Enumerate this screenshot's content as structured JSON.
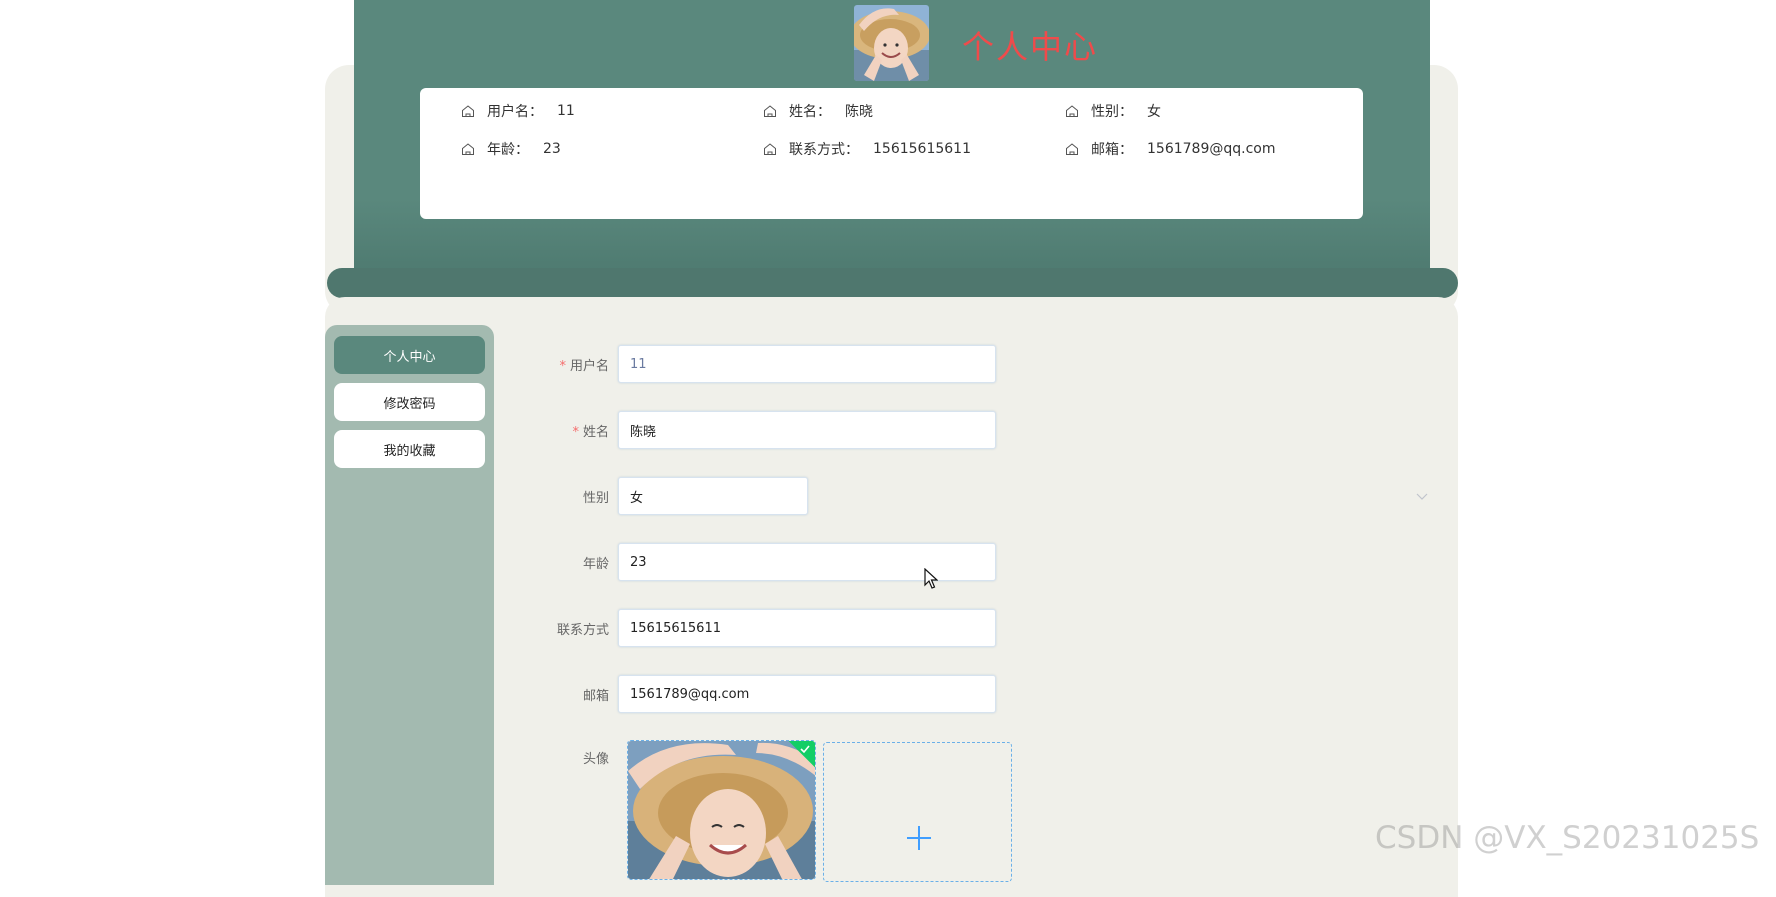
{
  "header": {
    "title": "个人中心"
  },
  "profile_card": {
    "row1": [
      {
        "label": "用户名：",
        "value": "11"
      },
      {
        "label": "姓名：",
        "value": "陈晓"
      },
      {
        "label": "性别：",
        "value": "女"
      }
    ],
    "row2": [
      {
        "label": "年龄：",
        "value": "23"
      },
      {
        "label": "联系方式：",
        "value": "15615615611"
      },
      {
        "label": "邮箱：",
        "value": "1561789@qq.com"
      }
    ]
  },
  "sidebar": {
    "items": [
      {
        "label": "个人中心",
        "active": true
      },
      {
        "label": "修改密码",
        "active": false
      },
      {
        "label": "我的收藏",
        "active": false
      }
    ]
  },
  "form": {
    "username": {
      "label": "用户名",
      "required": "*",
      "value": "11"
    },
    "name": {
      "label": "姓名",
      "required": "*",
      "value": "陈晓"
    },
    "gender": {
      "label": "性别",
      "value": "女"
    },
    "age": {
      "label": "年龄",
      "value": "23"
    },
    "phone": {
      "label": "联系方式",
      "value": "15615615611"
    },
    "email": {
      "label": "邮箱",
      "value": "1561789@qq.com"
    },
    "avatar": {
      "label": "头像"
    }
  },
  "colors": {
    "header_green": "#5a887d",
    "sidebar_green": "#a3bab0",
    "title_red": "#ef4b4b",
    "panel_bg": "#f0f0ea",
    "upload_success": "#13ce66",
    "upload_border": "#6bb0e8"
  },
  "watermark": "CSDN @VX_S20231025S"
}
